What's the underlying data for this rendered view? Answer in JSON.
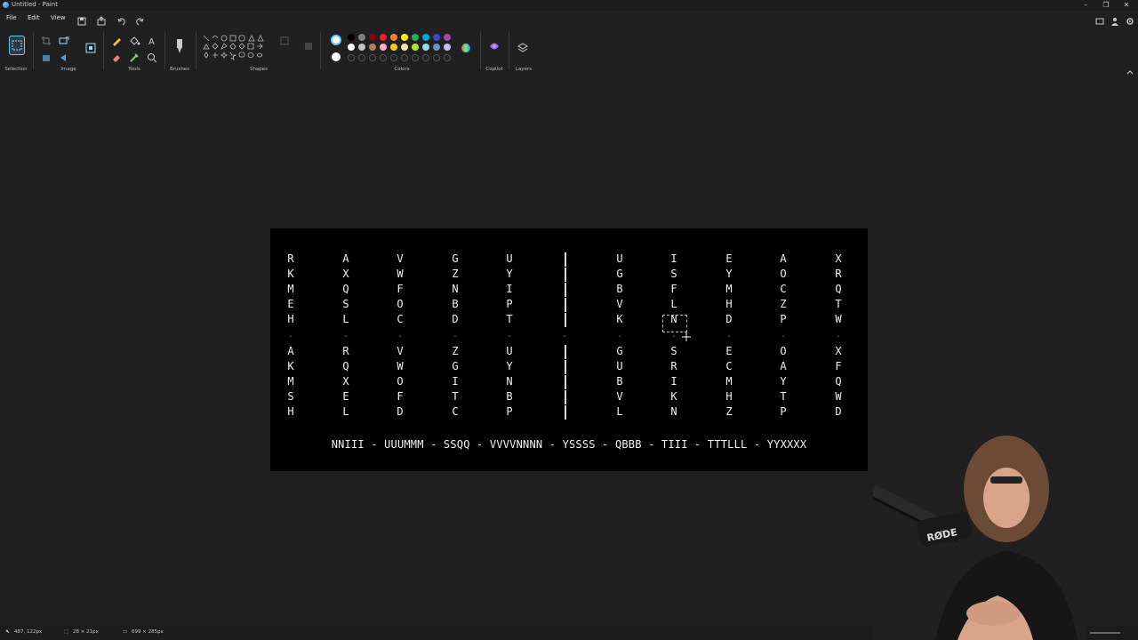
{
  "window": {
    "title": "Untitled - Paint"
  },
  "menu": {
    "file": "File",
    "edit": "Edit",
    "view": "View"
  },
  "ribbon": {
    "groups": {
      "selection": "Selection",
      "image": "Image",
      "tools": "Tools",
      "brushes": "Brushes",
      "shapes": "Shapes",
      "colors": "Colors",
      "copilot": "Copilot",
      "layers": "Layers"
    },
    "palette_row1": [
      "#000000",
      "#7f7f7f",
      "#880015",
      "#ed1c24",
      "#ff7f27",
      "#fff200",
      "#22b14c",
      "#00a2e8",
      "#3f48cc",
      "#a349a4"
    ],
    "palette_row2": [
      "#ffffff",
      "#c3c3c3",
      "#b97a57",
      "#ffaec9",
      "#ffc90e",
      "#efe4b0",
      "#b5e61d",
      "#99d9ea",
      "#7092be",
      "#c8bfe7"
    ],
    "accent": "#60cdff"
  },
  "puzzle": {
    "top_left": [
      [
        "R",
        "A",
        "V",
        "G",
        "U"
      ],
      [
        "K",
        "X",
        "W",
        "Z",
        "Y"
      ],
      [
        "M",
        "Q",
        "F",
        "N",
        "I"
      ],
      [
        "E",
        "S",
        "O",
        "B",
        "P"
      ],
      [
        "H",
        "L",
        "C",
        "D",
        "T"
      ]
    ],
    "top_right": [
      [
        "U",
        "I",
        "E",
        "A",
        "X"
      ],
      [
        "G",
        "S",
        "Y",
        "O",
        "R"
      ],
      [
        "B",
        "F",
        "M",
        "C",
        "Q"
      ],
      [
        "V",
        "L",
        "H",
        "Z",
        "T"
      ],
      [
        "K",
        "N",
        "D",
        "P",
        "W"
      ]
    ],
    "bottom_left": [
      [
        "A",
        "R",
        "V",
        "Z",
        "U"
      ],
      [
        "K",
        "Q",
        "W",
        "G",
        "Y"
      ],
      [
        "M",
        "X",
        "O",
        "I",
        "N"
      ],
      [
        "S",
        "E",
        "F",
        "T",
        "B"
      ],
      [
        "H",
        "L",
        "D",
        "C",
        "P"
      ]
    ],
    "bottom_right": [
      [
        "G",
        "S",
        "E",
        "O",
        "X"
      ],
      [
        "U",
        "R",
        "C",
        "A",
        "F"
      ],
      [
        "B",
        "I",
        "M",
        "Y",
        "Q"
      ],
      [
        "V",
        "K",
        "H",
        "T",
        "W"
      ],
      [
        "L",
        "N",
        "Z",
        "P",
        "D"
      ]
    ],
    "divider_char": "-",
    "answer_line": "NNIII - UUUMMM - SSQQ - VVVVNNNN - YSSSS - QBBB - TIII - TTTLLL - YYXXXX"
  },
  "status": {
    "cursor_pos": "487, 122px",
    "selection_size": "28 × 21px",
    "canvas_size": "699 × 285px"
  },
  "overlay": {
    "mic_brand": "RØDE"
  }
}
